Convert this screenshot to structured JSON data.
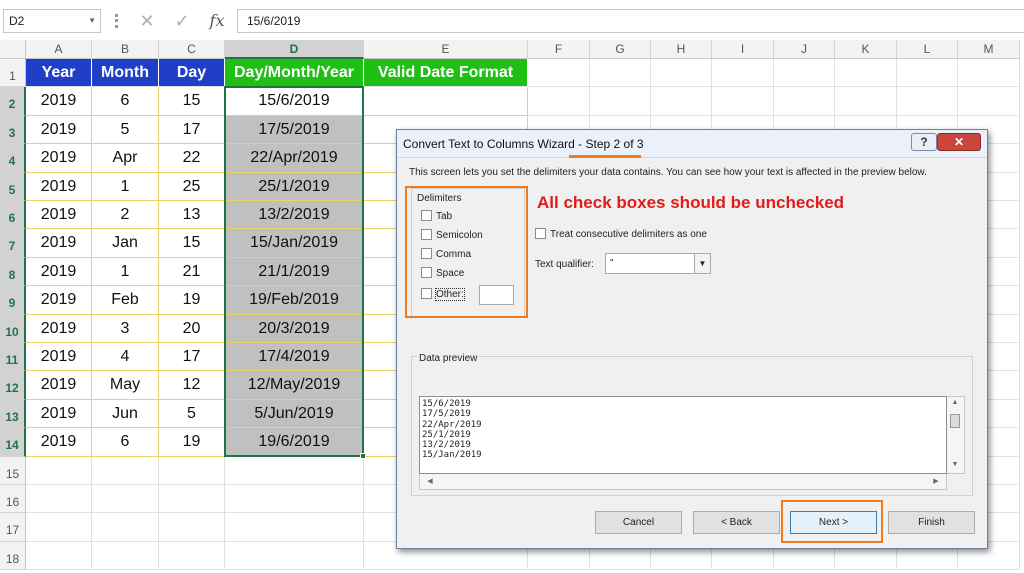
{
  "formula_bar": {
    "name_box": "D2",
    "cancel_icon": "✕",
    "enter_icon": "✓",
    "fx_label": "fx",
    "content": "15/6/2019"
  },
  "columns": [
    "A",
    "B",
    "C",
    "D",
    "E",
    "F",
    "G",
    "H",
    "I",
    "J",
    "K",
    "L",
    "M"
  ],
  "rows": [
    "1",
    "2",
    "3",
    "4",
    "5",
    "6",
    "7",
    "8",
    "9",
    "10",
    "11",
    "12",
    "13",
    "14",
    "15",
    "16",
    "17",
    "18"
  ],
  "headers": {
    "year": "Year",
    "month": "Month",
    "day": "Day",
    "dmy": "Day/Month/Year",
    "valid": "Valid Date Format"
  },
  "table": [
    [
      "2019",
      "6",
      "15",
      "15/6/2019"
    ],
    [
      "2019",
      "5",
      "17",
      "17/5/2019"
    ],
    [
      "2019",
      "Apr",
      "22",
      "22/Apr/2019"
    ],
    [
      "2019",
      "1",
      "25",
      "25/1/2019"
    ],
    [
      "2019",
      "2",
      "13",
      "13/2/2019"
    ],
    [
      "2019",
      "Jan",
      "15",
      "15/Jan/2019"
    ],
    [
      "2019",
      "1",
      "21",
      "21/1/2019"
    ],
    [
      "2019",
      "Feb",
      "19",
      "19/Feb/2019"
    ],
    [
      "2019",
      "3",
      "20",
      "20/3/2019"
    ],
    [
      "2019",
      "4",
      "17",
      "17/4/2019"
    ],
    [
      "2019",
      "May",
      "12",
      "12/May/2019"
    ],
    [
      "2019",
      "Jun",
      "5",
      "5/Jun/2019"
    ],
    [
      "2019",
      "6",
      "19",
      "19/6/2019"
    ]
  ],
  "dialog": {
    "title": "Convert Text to Columns Wizard - Step 2 of 3",
    "help_label": "?",
    "close_label": "✕",
    "intro": "This screen lets you set the delimiters your data contains.  You can see how your text is affected in the preview below.",
    "delimiters_label": "Delimiters",
    "checkboxes": [
      "Tab",
      "Semicolon",
      "Comma",
      "Space",
      "Other:"
    ],
    "annotation": "All check boxes should be unchecked",
    "consecutive_label": "Treat consecutive delimiters as one",
    "qualifier_label": "Text qualifier:",
    "qualifier_value": "\"",
    "preview_label": "Data preview",
    "preview_lines": [
      "15/6/2019",
      "17/5/2019",
      "22/Apr/2019",
      "25/1/2019",
      "13/2/2019",
      "15/Jan/2019"
    ],
    "buttons": {
      "cancel": "Cancel",
      "back": "< Back",
      "next": "Next >",
      "finish": "Finish"
    }
  },
  "colors": {
    "header_blue": "#1f3fc8",
    "header_green": "#1fbf16",
    "selection_green": "#217346",
    "highlight_orange": "#f07a1e",
    "annotation_red": "#e21b1b",
    "selected_gray": "#c0c0c0"
  }
}
